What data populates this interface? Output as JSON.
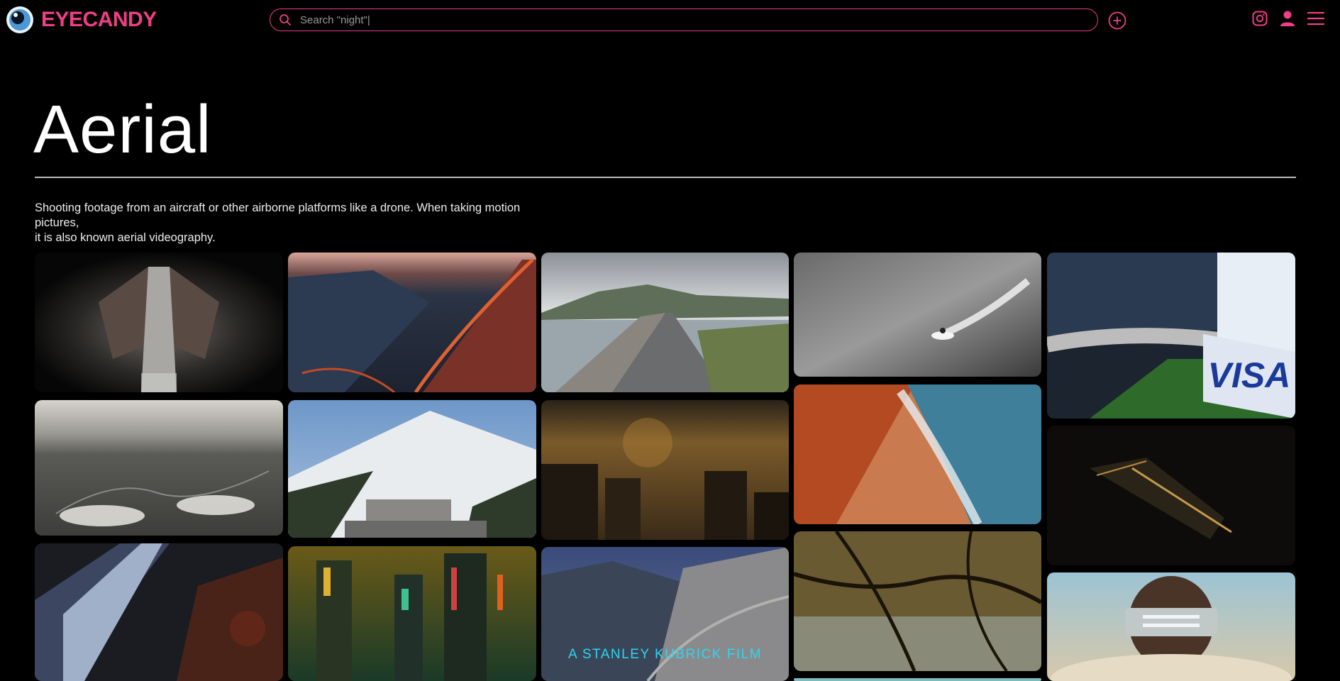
{
  "header": {
    "brand": "EYECANDY",
    "search_placeholder": "Search \"night\"|",
    "accent_color": "#ef3f86",
    "icons": [
      "eye-logo-icon",
      "search-icon",
      "plus-circle-icon",
      "instagram-icon",
      "user-icon",
      "menu-icon"
    ]
  },
  "page": {
    "title": "Aerial",
    "description_line1": "Shooting footage from an aircraft or other airborne platforms like a drone. When taking motion pictures,",
    "description_line2": "it is also known aerial videography."
  },
  "gallery": {
    "items": [
      {
        "subject": "Dark alley between houses"
      },
      {
        "subject": "Lava volcano"
      },
      {
        "subject": "Highway over water"
      },
      {
        "subject": "Jet ski black and white"
      },
      {
        "subject": "Stadium race track with Visa banner",
        "overlay_text": "VISA"
      },
      {
        "subject": "Desert landscape with birds"
      },
      {
        "subject": "Snowy mountain lodge"
      },
      {
        "subject": "City lights at night"
      },
      {
        "subject": "Beach waves on red sand"
      },
      {
        "subject": "Night bridge"
      },
      {
        "subject": "Mountain river"
      },
      {
        "subject": "Neon city"
      },
      {
        "subject": "Mountain road",
        "caption": "A STANLEY KUBRICK FILM"
      },
      {
        "subject": "Tree branches over water"
      },
      {
        "subject": "Person with visor above clouds"
      }
    ]
  }
}
